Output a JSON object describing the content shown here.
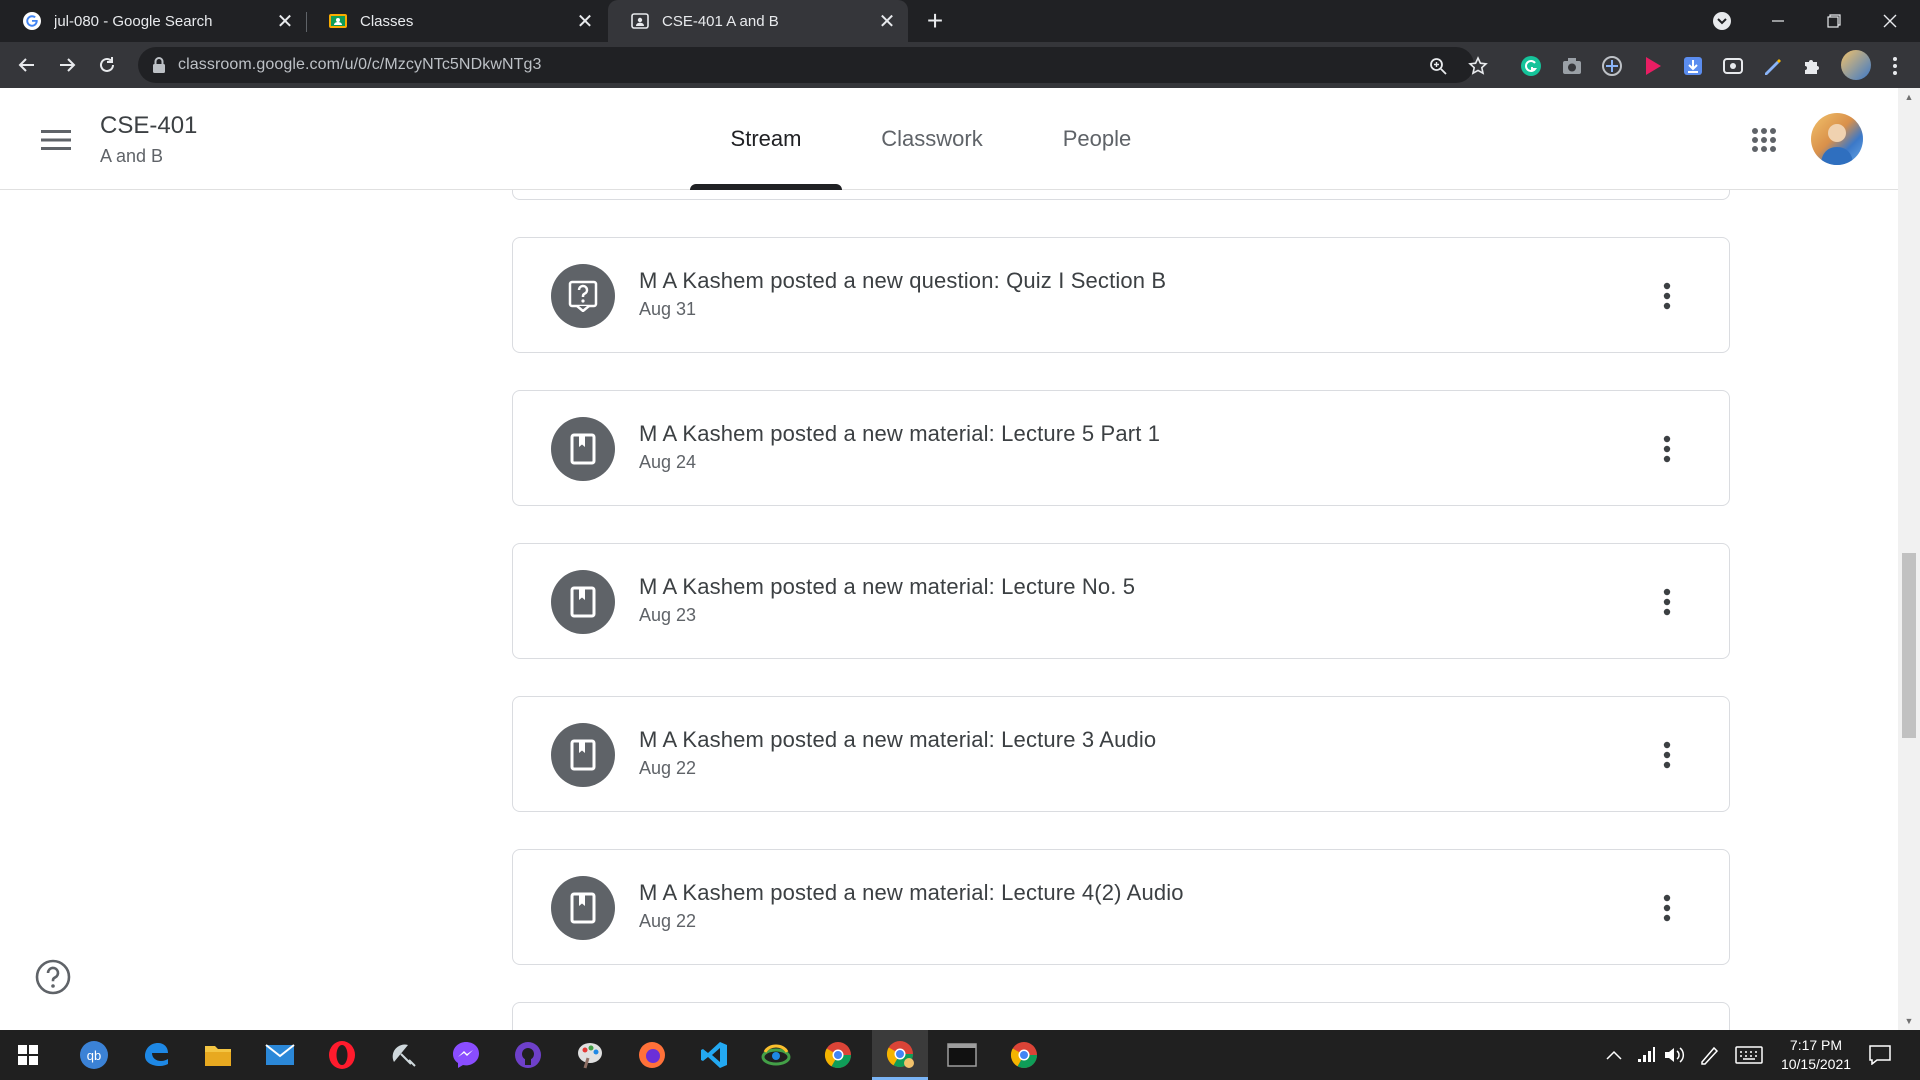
{
  "browser": {
    "tabs": [
      {
        "title": "jul-080 - Google Search",
        "favicon": "google-g-icon",
        "active": false
      },
      {
        "title": "Classes",
        "favicon": "classroom-icon",
        "active": false
      },
      {
        "title": "CSE-401 A and B",
        "favicon": "classroom-class-icon",
        "active": true
      }
    ],
    "address": "classroom.google.com/u/0/c/MzcyNTc5NDkwNTg3"
  },
  "classroom": {
    "title": "CSE-401",
    "subtitle": "A and B",
    "nav": [
      {
        "label": "Stream",
        "active": true
      },
      {
        "label": "Classwork",
        "active": false
      },
      {
        "label": "People",
        "active": false
      }
    ]
  },
  "stream": {
    "posts": [
      {
        "title": "M A Kashem posted a new question: Quiz I Section B",
        "date": "Aug 31",
        "icon": "question-icon"
      },
      {
        "title": "M A Kashem posted a new material: Lecture 5 Part 1",
        "date": "Aug 24",
        "icon": "material-icon"
      },
      {
        "title": "M A Kashem posted a new material: Lecture No. 5",
        "date": "Aug 23",
        "icon": "material-icon"
      },
      {
        "title": "M A Kashem posted a new material: Lecture 3 Audio",
        "date": "Aug 22",
        "icon": "material-icon"
      },
      {
        "title": "M A Kashem posted a new material: Lecture 4(2) Audio",
        "date": "Aug 22",
        "icon": "material-icon"
      }
    ]
  },
  "taskbar": {
    "time": "7:17 PM",
    "date": "10/15/2021"
  }
}
